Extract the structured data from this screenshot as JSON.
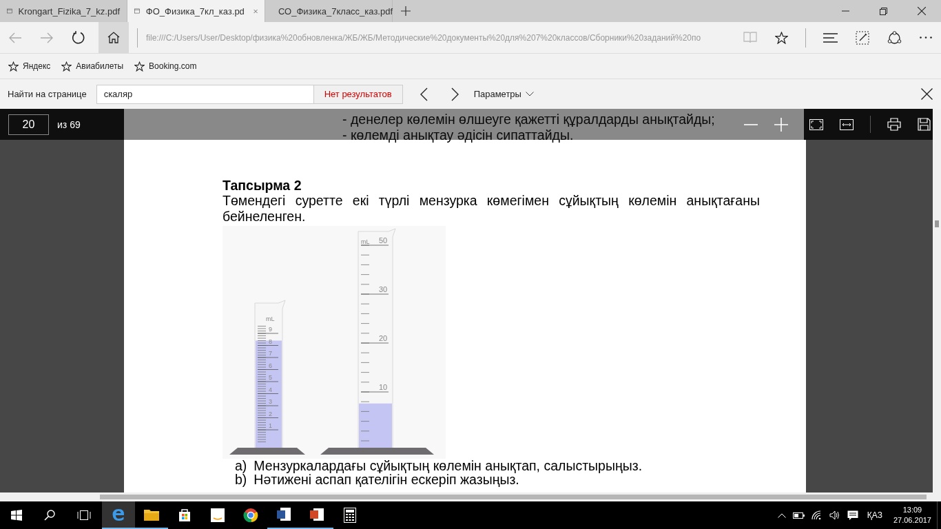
{
  "tabs": [
    {
      "title": "Krongart_Fizika_7_kz.pdf",
      "selected": false
    },
    {
      "title": "ФО_Физика_7кл_каз.pd",
      "selected": true
    },
    {
      "title": "СО_Физика_7класс_каз.pdf",
      "selected": false
    }
  ],
  "address_bar": {
    "url": "file:///C:/Users/User/Desktop/физика%20обновленка/ЖБ/ЖБ/Методические%20документы%20для%207%20классов/Сборники%20заданий%20по"
  },
  "favorites": [
    "Яндекс",
    "Авиабилеты",
    "Booking.com"
  ],
  "find_bar": {
    "label": "Найти на странице",
    "value": "скаляр",
    "result": "Нет результатов",
    "options": "Параметры"
  },
  "pdf_toolbar": {
    "page": "20",
    "page_count": "из 69"
  },
  "document": {
    "descriptor_items": [
      "- денелер көлемін өлшеуге қажетті құралдарды анықтайды;",
      "- көлемді анықтау әдісін сипаттайды."
    ],
    "task_title": "Тапсырма 2",
    "task_text": "Төмендегі суретте екі түрлі мензурка көмегімен сұйықтың көлемін анықтағаны бейнеленген.",
    "figure": {
      "cylinders": [
        {
          "unit": "mL",
          "labels": [
            "9",
            "8",
            "7",
            "6",
            "5",
            "4",
            "3",
            "2",
            "1"
          ],
          "level": 0.77
        },
        {
          "unit": "mL",
          "labels": [
            "50",
            "30",
            "20",
            "10"
          ],
          "level": 0.21
        }
      ]
    },
    "questions": [
      {
        "marker": "a)",
        "text": "Мензуркалардағы сұйықтың көлемін анықтап, салыстырыңыз."
      },
      {
        "marker": "b)",
        "text": "Нәтижені аспап қателігін ескеріп жазыңыз."
      }
    ]
  },
  "taskbar": {
    "language": "ҚАЗ",
    "time": "13:09",
    "date": "27.06.2017"
  }
}
